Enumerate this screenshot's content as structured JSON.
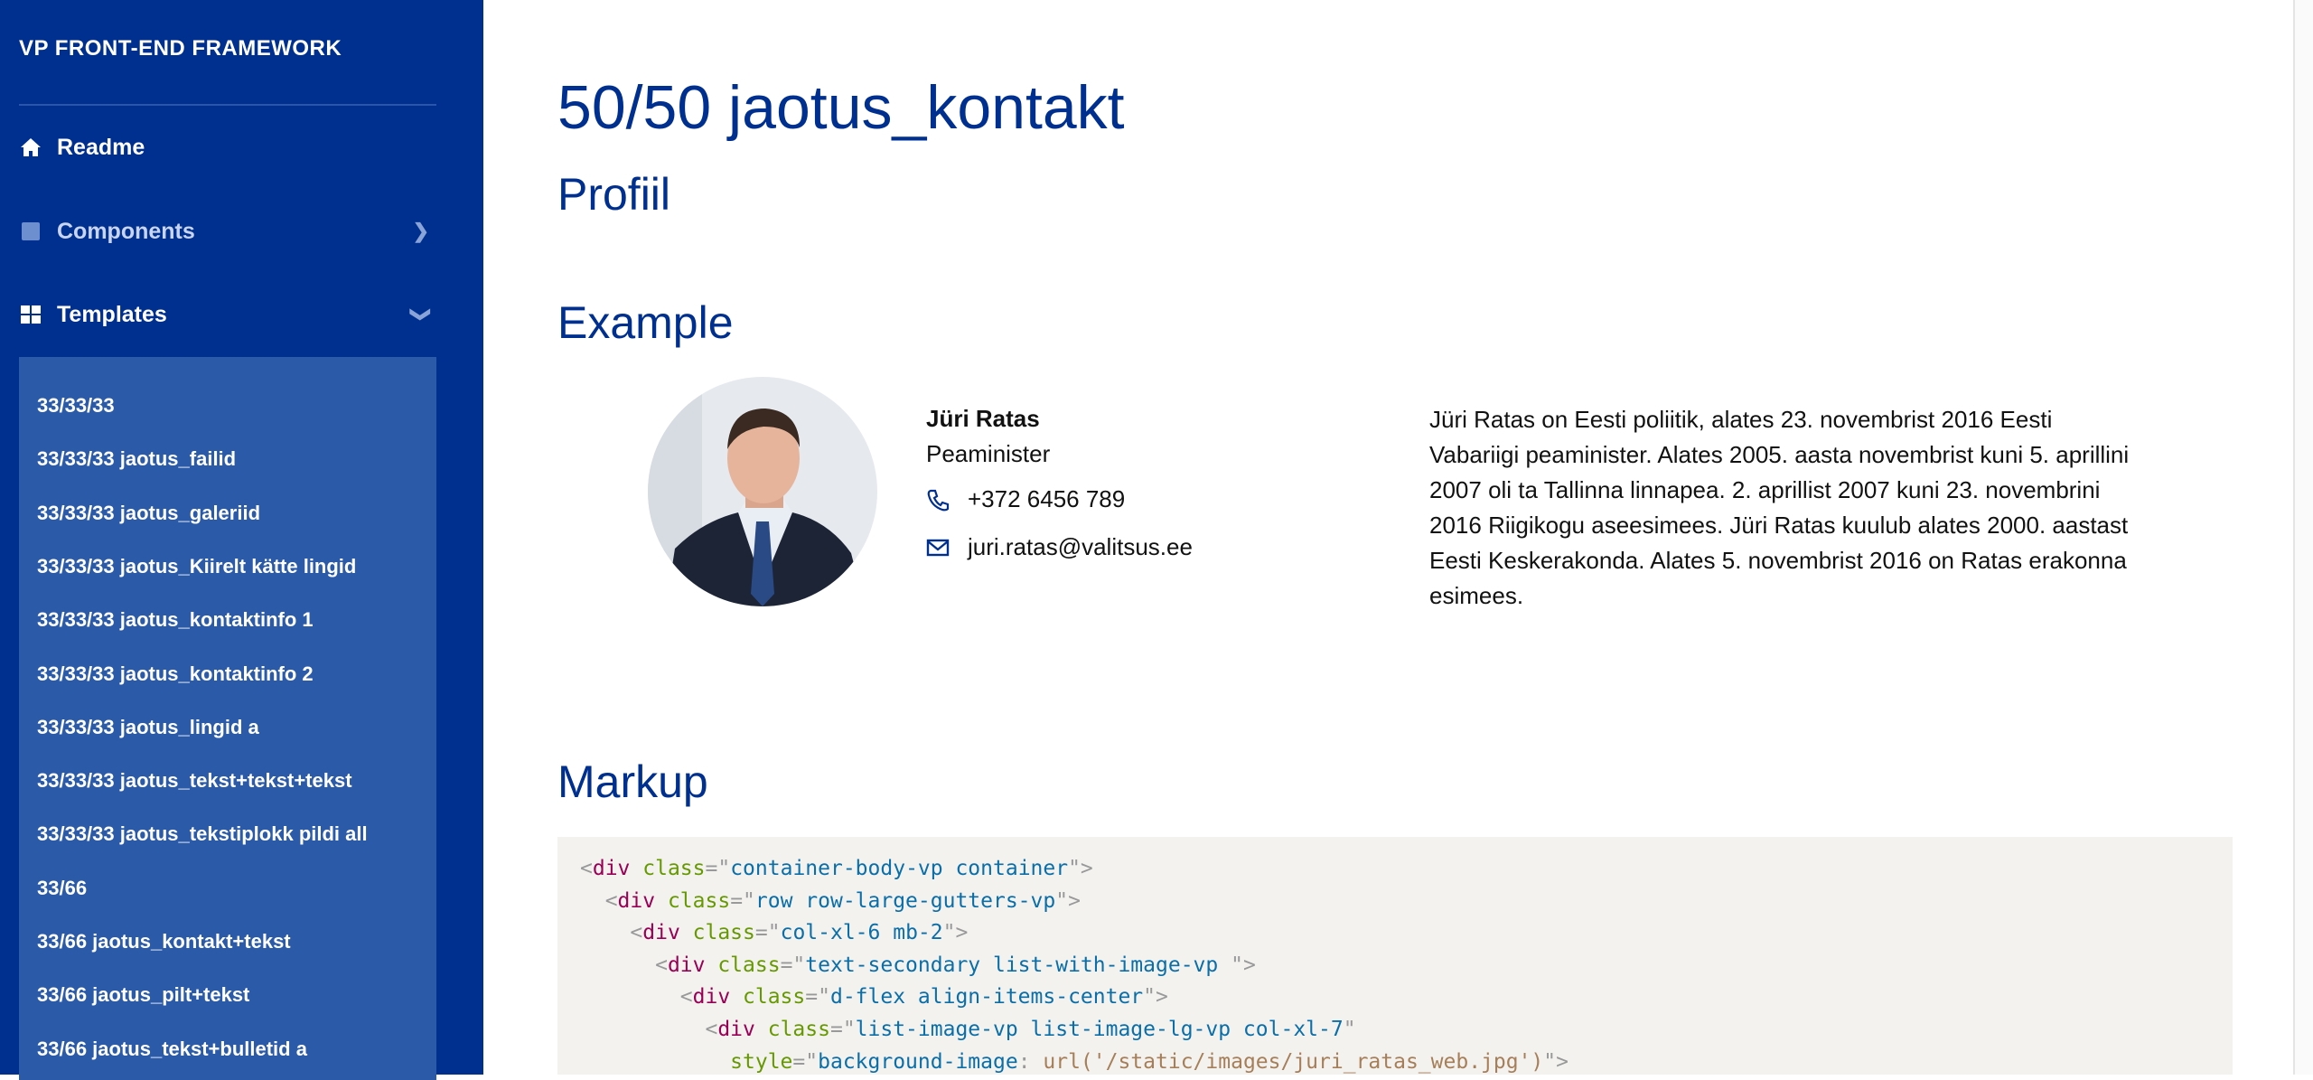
{
  "sidebar": {
    "brand": "VP FRONT-END FRAMEWORK",
    "nav": [
      {
        "label": "Readme",
        "icon": "home-icon"
      },
      {
        "label": "Components",
        "icon": "square-icon"
      },
      {
        "label": "Templates",
        "icon": "grid-icon"
      }
    ],
    "templates": [
      "33/33/33",
      "33/33/33 jaotus_failid",
      "33/33/33 jaotus_galeriid",
      "33/33/33 jaotus_Kiirelt kätte lingid",
      "33/33/33 jaotus_kontaktinfo 1",
      "33/33/33 jaotus_kontaktinfo 2",
      "33/33/33 jaotus_lingid a",
      "33/33/33 jaotus_tekst+tekst+tekst",
      "33/33/33 jaotus_tekstiplokk pildi all",
      "33/66",
      "33/66 jaotus_kontakt+tekst",
      "33/66 jaotus_pilt+tekst",
      "33/66 jaotus_tekst+bulletid a"
    ]
  },
  "main": {
    "title": "50/50 jaotus_kontakt",
    "subtitle": "Profiil",
    "example_heading": "Example",
    "markup_heading": "Markup",
    "contact": {
      "name": "Jüri Ratas",
      "role": "Peaminister",
      "phone": "+372 6456 789",
      "email": "juri.ratas@valitsus.ee"
    },
    "bio": "Jüri Ratas on Eesti poliitik, alates 23. novembrist 2016 Eesti Vabariigi peaminister. Alates 2005. aasta novembrist kuni 5. aprillini 2007 oli ta Tallinna linnapea. 2. aprillist 2007 kuni 23. novembrini 2016 Riigikogu aseesimees. Jüri Ratas kuulub alates 2000. aastast Eesti Keskerakonda. Alates 5. novembrist 2016 on Ratas erakonna esimees.",
    "code_lines": [
      [
        [
          "p",
          "<"
        ],
        [
          "t",
          "div"
        ],
        [
          "a",
          " class"
        ],
        [
          "p",
          "=\""
        ],
        [
          "v",
          "container-body-vp container"
        ],
        [
          "p",
          "\">"
        ]
      ],
      [
        [
          "p",
          "  <"
        ],
        [
          "t",
          "div"
        ],
        [
          "a",
          " class"
        ],
        [
          "p",
          "=\""
        ],
        [
          "v",
          "row row-large-gutters-vp"
        ],
        [
          "p",
          "\">"
        ]
      ],
      [
        [
          "p",
          "    <"
        ],
        [
          "t",
          "div"
        ],
        [
          "a",
          " class"
        ],
        [
          "p",
          "=\""
        ],
        [
          "v",
          "col-xl-6 mb-2"
        ],
        [
          "p",
          "\">"
        ]
      ],
      [
        [
          "p",
          "      <"
        ],
        [
          "t",
          "div"
        ],
        [
          "a",
          " class"
        ],
        [
          "p",
          "=\""
        ],
        [
          "v",
          "text-secondary list-with-image-vp "
        ],
        [
          "p",
          "\">"
        ]
      ],
      [
        [
          "p",
          "        <"
        ],
        [
          "t",
          "div"
        ],
        [
          "a",
          " class"
        ],
        [
          "p",
          "=\""
        ],
        [
          "v",
          "d-flex align-items-center"
        ],
        [
          "p",
          "\">"
        ]
      ],
      [
        [
          "p",
          "          <"
        ],
        [
          "t",
          "div"
        ],
        [
          "a",
          " class"
        ],
        [
          "p",
          "=\""
        ],
        [
          "v",
          "list-image-vp list-image-lg-vp col-xl-7"
        ],
        [
          "p",
          "\""
        ]
      ],
      [
        [
          "p",
          "            "
        ],
        [
          "a",
          "style"
        ],
        [
          "p",
          "=\""
        ],
        [
          "v",
          "background-image"
        ],
        [
          "p",
          ": "
        ],
        [
          "u",
          "url('/static/images/juri_ratas_web.jpg')"
        ],
        [
          "p",
          "\">"
        ]
      ]
    ]
  },
  "colors": {
    "sidebar": "#00308f",
    "submenu": "#2a5aa8",
    "heading": "#00308f",
    "code_bg": "#f3f2ef"
  }
}
